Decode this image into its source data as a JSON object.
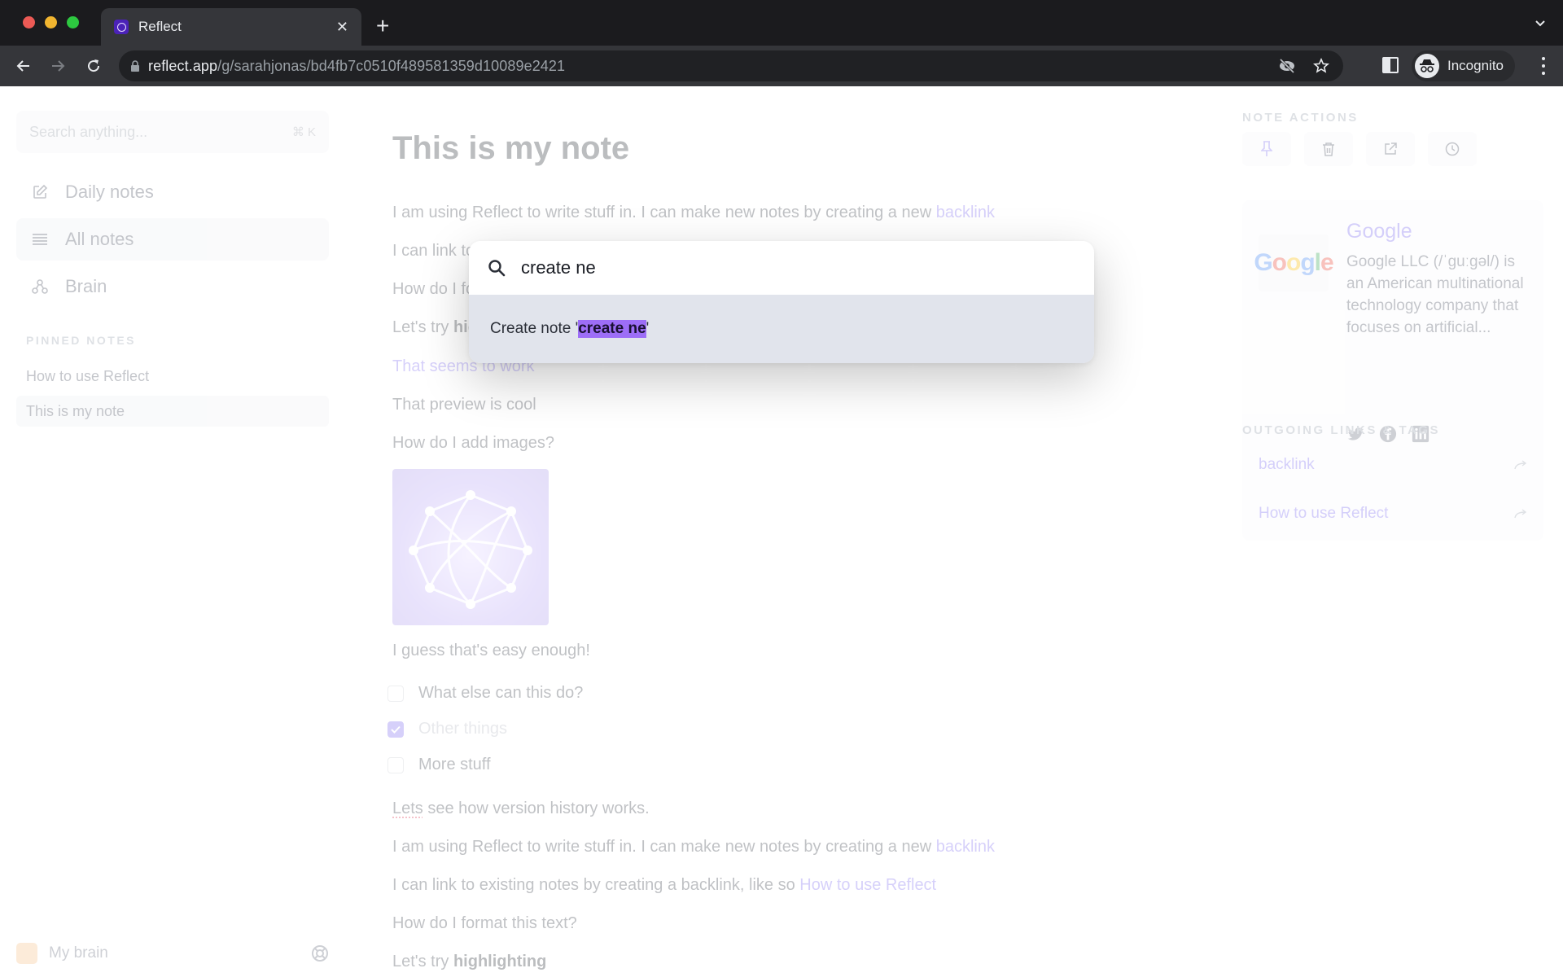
{
  "browser": {
    "tab_title": "Reflect",
    "url_host": "reflect.app",
    "url_path": "/g/sarahjonas/bd4fb7c0510f489581359d10089e2421",
    "profile_label": "Incognito"
  },
  "sidebar": {
    "search_placeholder": "Search anything...",
    "search_shortcut": "⌘ K",
    "nav": [
      {
        "label": "Daily notes",
        "icon": "edit-icon"
      },
      {
        "label": "All notes",
        "icon": "list-icon",
        "active": true
      },
      {
        "label": "Brain",
        "icon": "graph-icon"
      }
    ],
    "pinned_label": "PINNED NOTES",
    "pinned": [
      {
        "label": "How to use Reflect"
      },
      {
        "label": "This is my note",
        "active": true
      }
    ],
    "footer_label": "My brain"
  },
  "note": {
    "title": "This is my note",
    "lines": {
      "l1": "I am using Reflect to write stuff in. I can make new notes by creating a new ",
      "l1_link": "backlink",
      "l2": "I can link to existing notes by creating a backlink, like so ",
      "l2_link": "How to use Reflect",
      "l3": "How do I format this text?",
      "l4_pre": "Let's try ",
      "l4_bold": "highlighting",
      "l5": "That seems to work",
      "l6": "That preview is cool",
      "l7": "How do I add images?",
      "l8": "I guess that's easy enough!",
      "l9_spell": "Lets",
      "l9_rest": " see how version history works.",
      "l10": "I am using Reflect to write stuff in. I can make new notes by creating a new ",
      "l10_link": "backlink",
      "l11": "I can link to existing notes by creating a backlink, like so ",
      "l11_link": "How to use Reflect",
      "l12": "How do I format this text?",
      "l13_pre": "Let's try ",
      "l13_bold": "highlighting"
    },
    "todos": [
      {
        "label": "What else can this do?",
        "checked": false
      },
      {
        "label": "Other things",
        "checked": true
      },
      {
        "label": "More stuff",
        "checked": false
      }
    ]
  },
  "right_panel": {
    "actions_label": "NOTE ACTIONS",
    "actions": [
      "pin-icon",
      "trash-icon",
      "external-link-icon",
      "history-icon"
    ],
    "preview": {
      "logo_text": "Google",
      "title": "Google",
      "description": "Google LLC (/ˈɡuːɡəl/) is an American multinational technology company that focuses on artificial..."
    },
    "links_label": "OUTGOING LINKS & TAGS",
    "links": [
      "backlink",
      "How to use Reflect"
    ]
  },
  "palette": {
    "query": "create ne",
    "result_prefix": "Create note '",
    "result_highlight": "create ne",
    "result_suffix": "'"
  },
  "colors": {
    "accent": "#7d6bf0",
    "highlight": "#9d6ef7",
    "result_bg": "#e1e4ec"
  }
}
